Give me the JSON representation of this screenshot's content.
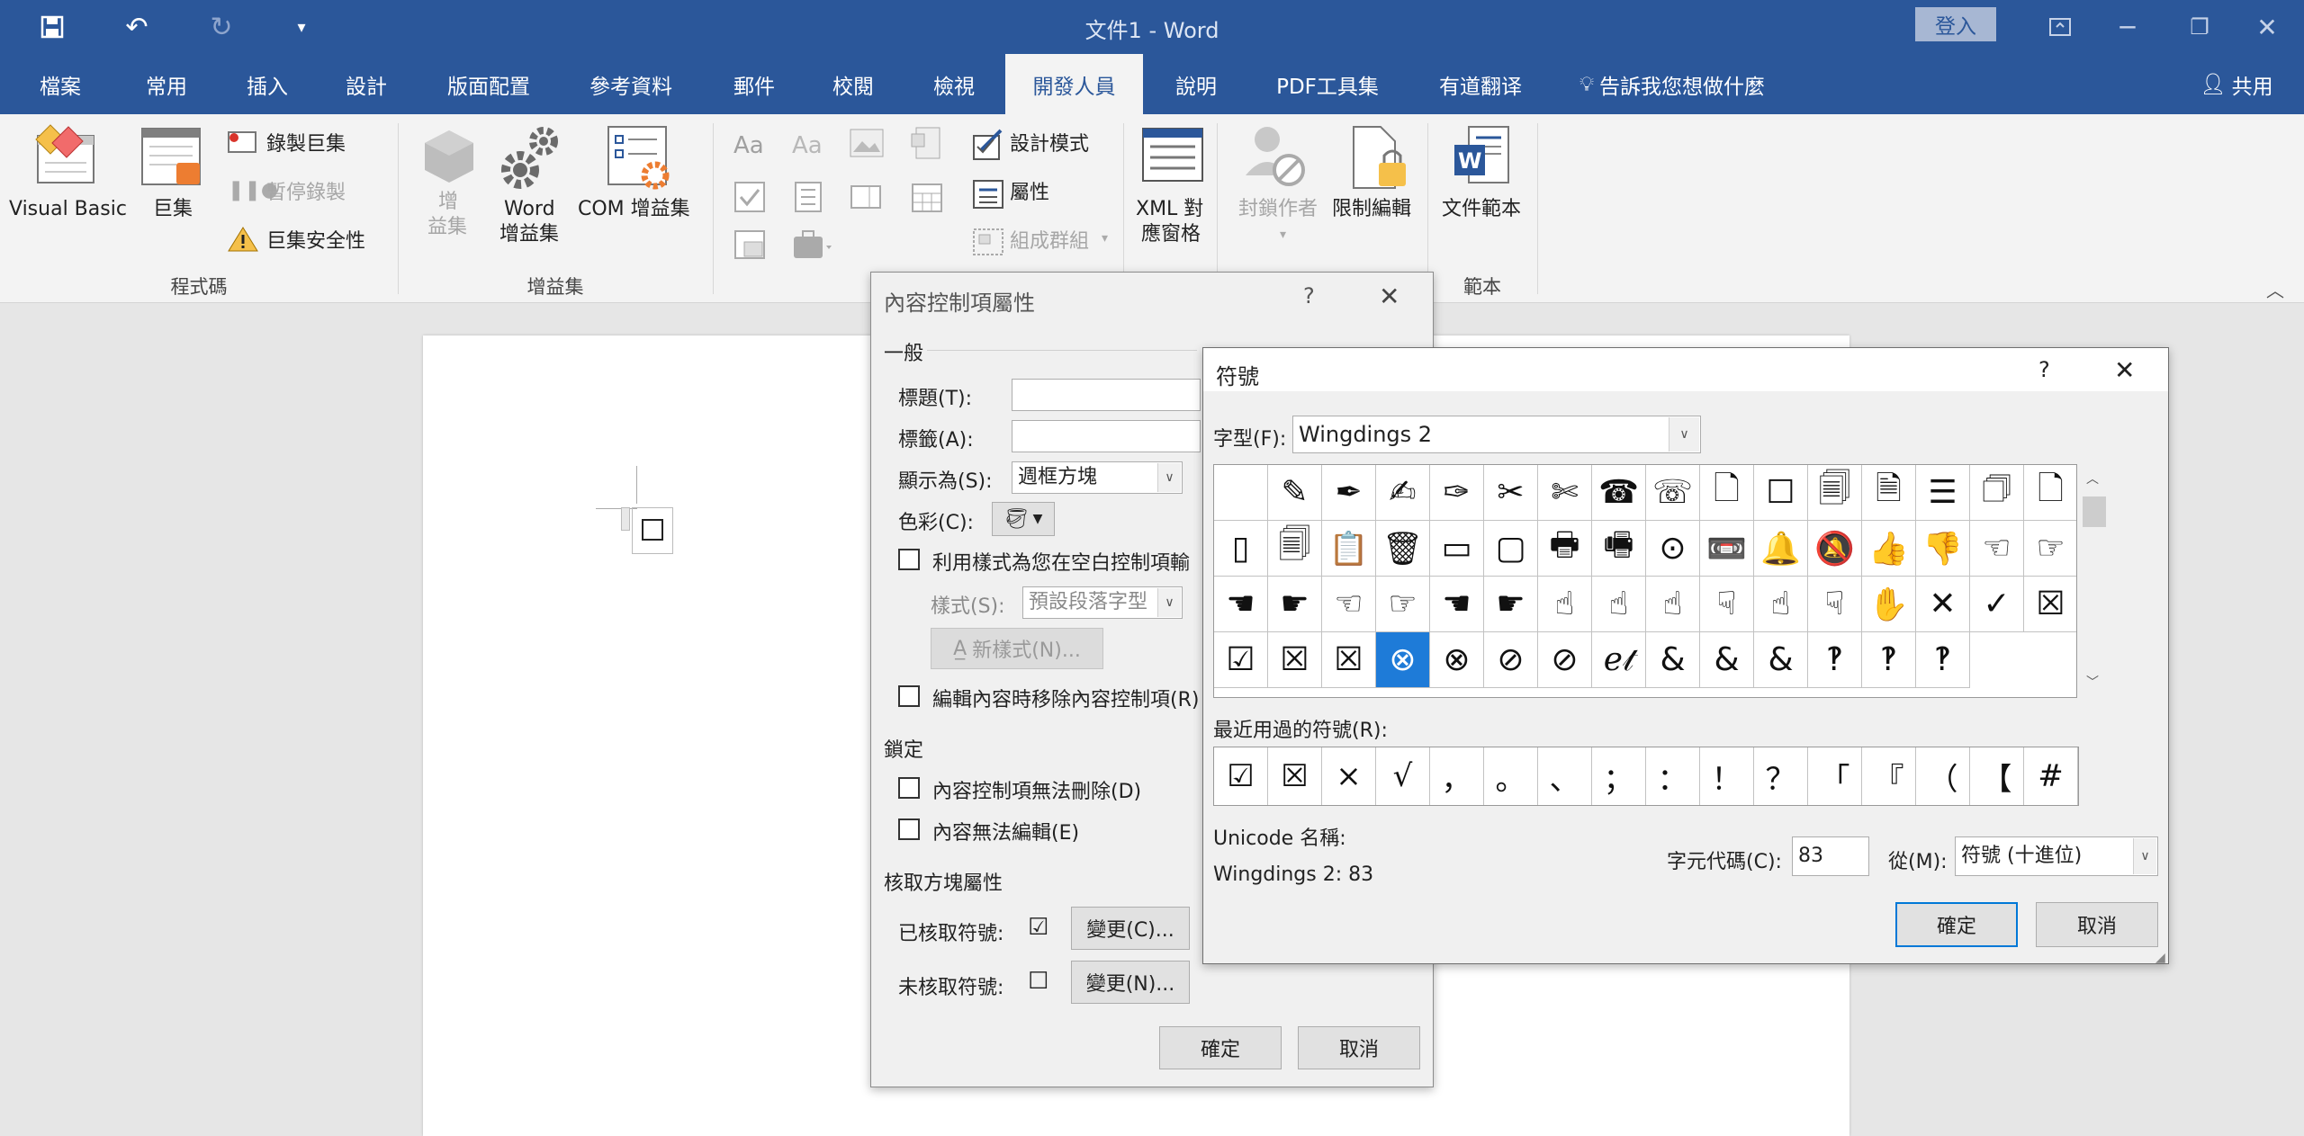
{
  "window": {
    "title": "文件1  -  Word",
    "login": "登入",
    "share": "共用"
  },
  "menu": {
    "tabs": [
      "檔案",
      "常用",
      "插入",
      "設計",
      "版面配置",
      "參考資料",
      "郵件",
      "校閱",
      "檢視",
      "開發人員",
      "說明",
      "PDF工具集",
      "有道翻译"
    ],
    "tell_me": "告訴我您想做什麼",
    "active": "開發人員"
  },
  "ribbon": {
    "code": {
      "visual_basic": "Visual Basic",
      "macros": "巨集",
      "record_macro": "錄製巨集",
      "pause_recording": "暫停錄製",
      "macro_security": "巨集安全性",
      "group": "程式碼"
    },
    "addins": {
      "addins_l1": "增",
      "addins_l2": "益集",
      "word_l1": "Word",
      "word_l2": "增益集",
      "com": "COM 增益集",
      "group": "增益集"
    },
    "controls": {
      "design_mode": "設計模式",
      "properties": "屬性",
      "group_btn": "組成群組"
    },
    "mapping": {
      "xml_l1": "XML 對",
      "xml_l2": "應窗格"
    },
    "protect": {
      "block_authors": "封鎖作者",
      "restrict_editing": "限制編輯"
    },
    "templates": {
      "doc_template": "文件範本",
      "group": "範本"
    }
  },
  "ccprops": {
    "title": "內容控制項屬性",
    "help": "?",
    "general": "一般",
    "title_label": "標題(T):",
    "tag_label": "標籤(A):",
    "show_as_label": "顯示為(S):",
    "show_as_value": "週框方塊",
    "color_label": "色彩(C):",
    "use_style": "利用樣式為您在空白控制項輸",
    "style_label": "樣式(S):",
    "style_value": "預設段落字型",
    "new_style": "新樣式(N)...",
    "remove_on_edit": "編輯內容時移除內容控制項(R)",
    "locking": "鎖定",
    "no_delete": "內容控制項無法刪除(D)",
    "no_edit": "內容無法編輯(E)",
    "checkbox_props": "核取方塊屬性",
    "checked_label": "已核取符號:",
    "checked_sym": "☑",
    "change_c": "變更(C)...",
    "unchecked_label": "未核取符號:",
    "unchecked_sym": "☐",
    "change_n": "變更(N)...",
    "ok": "確定",
    "cancel": "取消"
  },
  "symbol": {
    "title": "符號",
    "help": "?",
    "font_label": "字型(F):",
    "font_value": "Wingdings 2",
    "grid": [
      " ",
      "✎",
      "✒",
      "✍",
      "✑",
      "✂",
      "✄",
      "☎",
      "☏",
      "🗋",
      "☐",
      "🗐",
      "🗎",
      "☰",
      "🗇",
      "🗋",
      "▯",
      "🗐",
      "📋",
      "🗑",
      "▭",
      "▢",
      "🖶",
      "🖷",
      "⊙",
      "📼",
      "🔔",
      "🔕",
      "👍",
      "👎",
      "☜",
      "☞",
      "☚",
      "☛",
      "☜",
      "☞",
      "☚",
      "☛",
      "☝",
      "☝",
      "☝",
      "☟",
      "☝",
      "☟",
      "✋",
      "✕",
      "✓",
      "☒",
      "☑",
      "☒",
      "☒",
      "⊗",
      "⊗",
      "⊘",
      "⊘",
      "ℯ𝓉",
      "&",
      "&",
      "&",
      "‽",
      "‽",
      "‽"
    ],
    "selected_index": 51,
    "recent_label": "最近用過的符號(R):",
    "recent": [
      "☑",
      "☒",
      "×",
      "√",
      "，",
      "。",
      "、",
      "；",
      "：",
      "！",
      "？",
      "「",
      "『",
      "（",
      "【",
      "#"
    ],
    "unicode_name_label": "Unicode 名稱:",
    "unicode_name_value": "Wingdings 2: 83",
    "char_code_label": "字元代碼(C):",
    "char_code_value": "83",
    "from_label": "從(M):",
    "from_value": "符號 (十進位)",
    "ok": "確定",
    "cancel": "取消"
  },
  "colors": {
    "accent": "#2b579a",
    "select": "#1e7bd8"
  }
}
